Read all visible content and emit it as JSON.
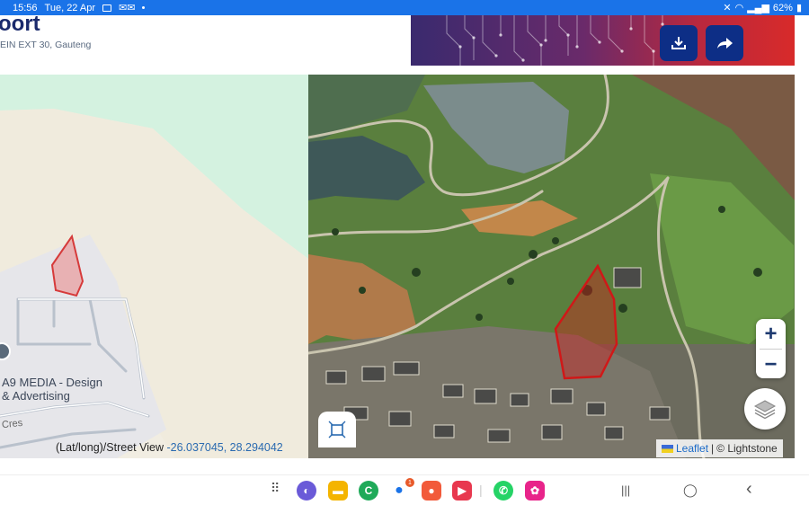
{
  "status_bar": {
    "time": "15:56",
    "date": "Tue, 22 Apr",
    "battery": "62%"
  },
  "header": {
    "title": "oort",
    "address": "EIN EXT 30, Gauteng",
    "download_icon": "download-icon",
    "share_icon": "share-icon",
    "accent": "#0d2e86"
  },
  "left_map": {
    "poi_label_line1": "A9 MEDIA - Design",
    "poi_label_line2": "& Advertising",
    "street_label": "Cres",
    "parcel_color": "#e05050"
  },
  "right_map": {
    "parcel_color": "#d01818"
  },
  "coords": {
    "prefix": "(Lat/long)/Street View",
    "value": "-26.037045, 28.294042"
  },
  "attribution": {
    "leaflet": "Leaflet",
    "separator": "|",
    "provider": "© Lightstone"
  },
  "controls": {
    "zoom_in": "+",
    "zoom_out": "−"
  },
  "nav": {
    "badge_count": "1",
    "recent_key": "|||",
    "home_key": "◯",
    "back_key": "‹"
  }
}
